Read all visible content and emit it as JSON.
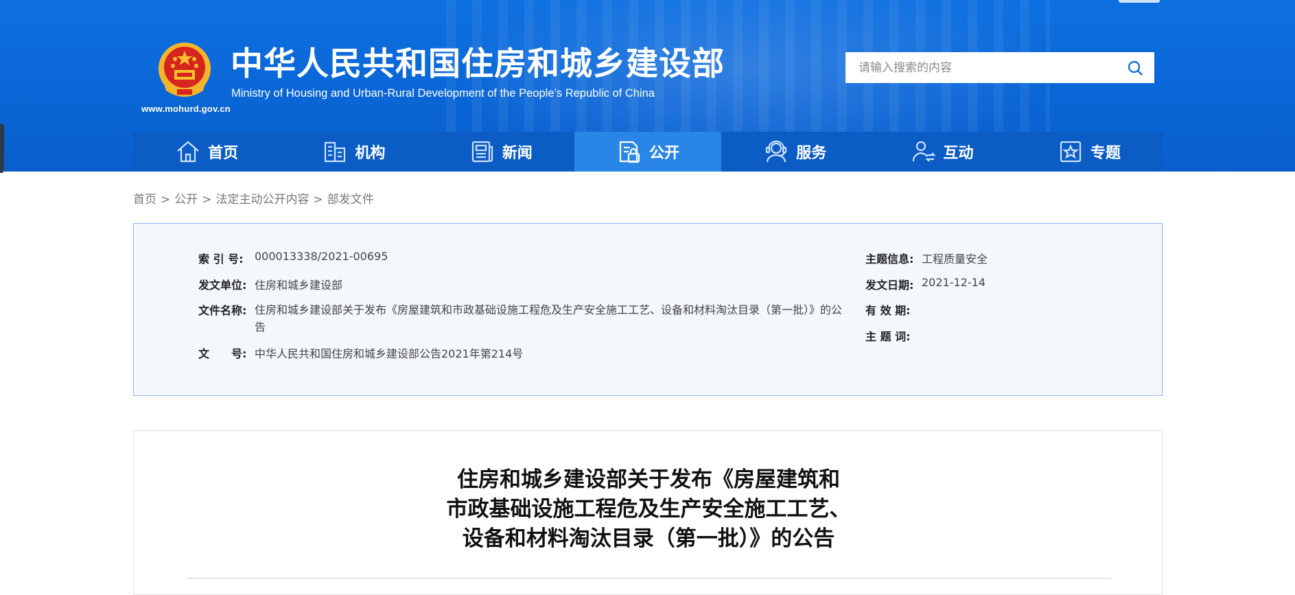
{
  "header": {
    "title_cn": "中华人民共和国住房和城乡建设部",
    "title_en": "Ministry of Housing and Urban-Rural Development of the People’s Republic of China",
    "site_url": "www.mohurd.gov.cn",
    "brand_color": "#0b66d6"
  },
  "search": {
    "placeholder": "请输入搜索的内容",
    "icon": "search-icon"
  },
  "nav": {
    "items": [
      {
        "label": "首页",
        "icon": "home-icon"
      },
      {
        "label": "机构",
        "icon": "building-icon"
      },
      {
        "label": "新闻",
        "icon": "newspaper-icon"
      },
      {
        "label": "公开",
        "icon": "document-icon",
        "active": true
      },
      {
        "label": "服务",
        "icon": "service-agent-icon"
      },
      {
        "label": "互动",
        "icon": "interaction-icon"
      },
      {
        "label": "专题",
        "icon": "star-board-icon"
      }
    ],
    "active_color": "#2a86e6"
  },
  "breadcrumb": {
    "items": [
      "首页",
      "公开",
      "法定主动公开内容",
      "部发文件"
    ],
    "separator": ">"
  },
  "info": {
    "index_no_label": "索 引 号:",
    "index_no": "000013338/2021-00695",
    "issuer_label": "发文单位:",
    "issuer": "住房和城乡建设部",
    "doc_name_label": "文件名称:",
    "doc_name": "住房和城乡建设部关于发布《房屋建筑和市政基础设施工程危及生产安全施工工艺、设备和材料淘汰目录（第一批）》的公告",
    "doc_no_label": "文　　号:",
    "doc_no": "中华人民共和国住房和城乡建设部公告2021年第214号",
    "topic_label": "主题信息:",
    "topic": "工程质量安全",
    "date_label": "发文日期:",
    "date": "2021-12-14",
    "validity_label": "有 效 期:",
    "validity": "",
    "keywords_label": "主 题 词:",
    "keywords": ""
  },
  "article": {
    "title_lines": [
      "住房和城乡建设部关于发布《房屋建筑和",
      "市政基础设施工程危及生产安全施工工艺、",
      "设备和材料淘汰目录（第一批）》的公告"
    ]
  }
}
